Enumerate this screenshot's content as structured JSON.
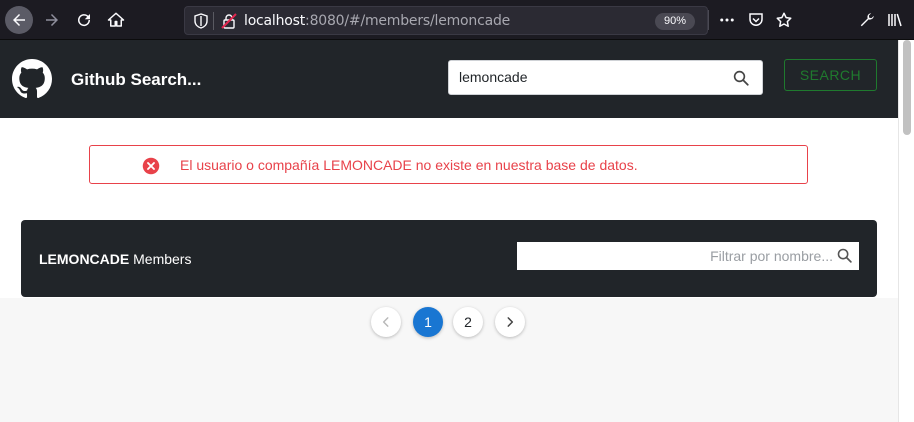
{
  "browser": {
    "url_host": "localhost",
    "url_rest": ":8080/#/members/lemoncade",
    "zoom": "90%"
  },
  "header": {
    "title": "Github Search...",
    "search_value": "lemoncade",
    "search_button": "SEARCH"
  },
  "alert": {
    "message": "El usuario o compañía LEMONCADE no existe en nuestra base de datos."
  },
  "members": {
    "org": "LEMONCADE",
    "suffix": " Members",
    "filter_placeholder": "Filtrar por nombre..."
  },
  "pagination": {
    "pages": [
      "1",
      "2"
    ],
    "current": "1"
  },
  "colors": {
    "accent": "#1976d2",
    "error": "#e8424a",
    "search_button": "#1f7a2e",
    "header_bg": "#212529"
  }
}
